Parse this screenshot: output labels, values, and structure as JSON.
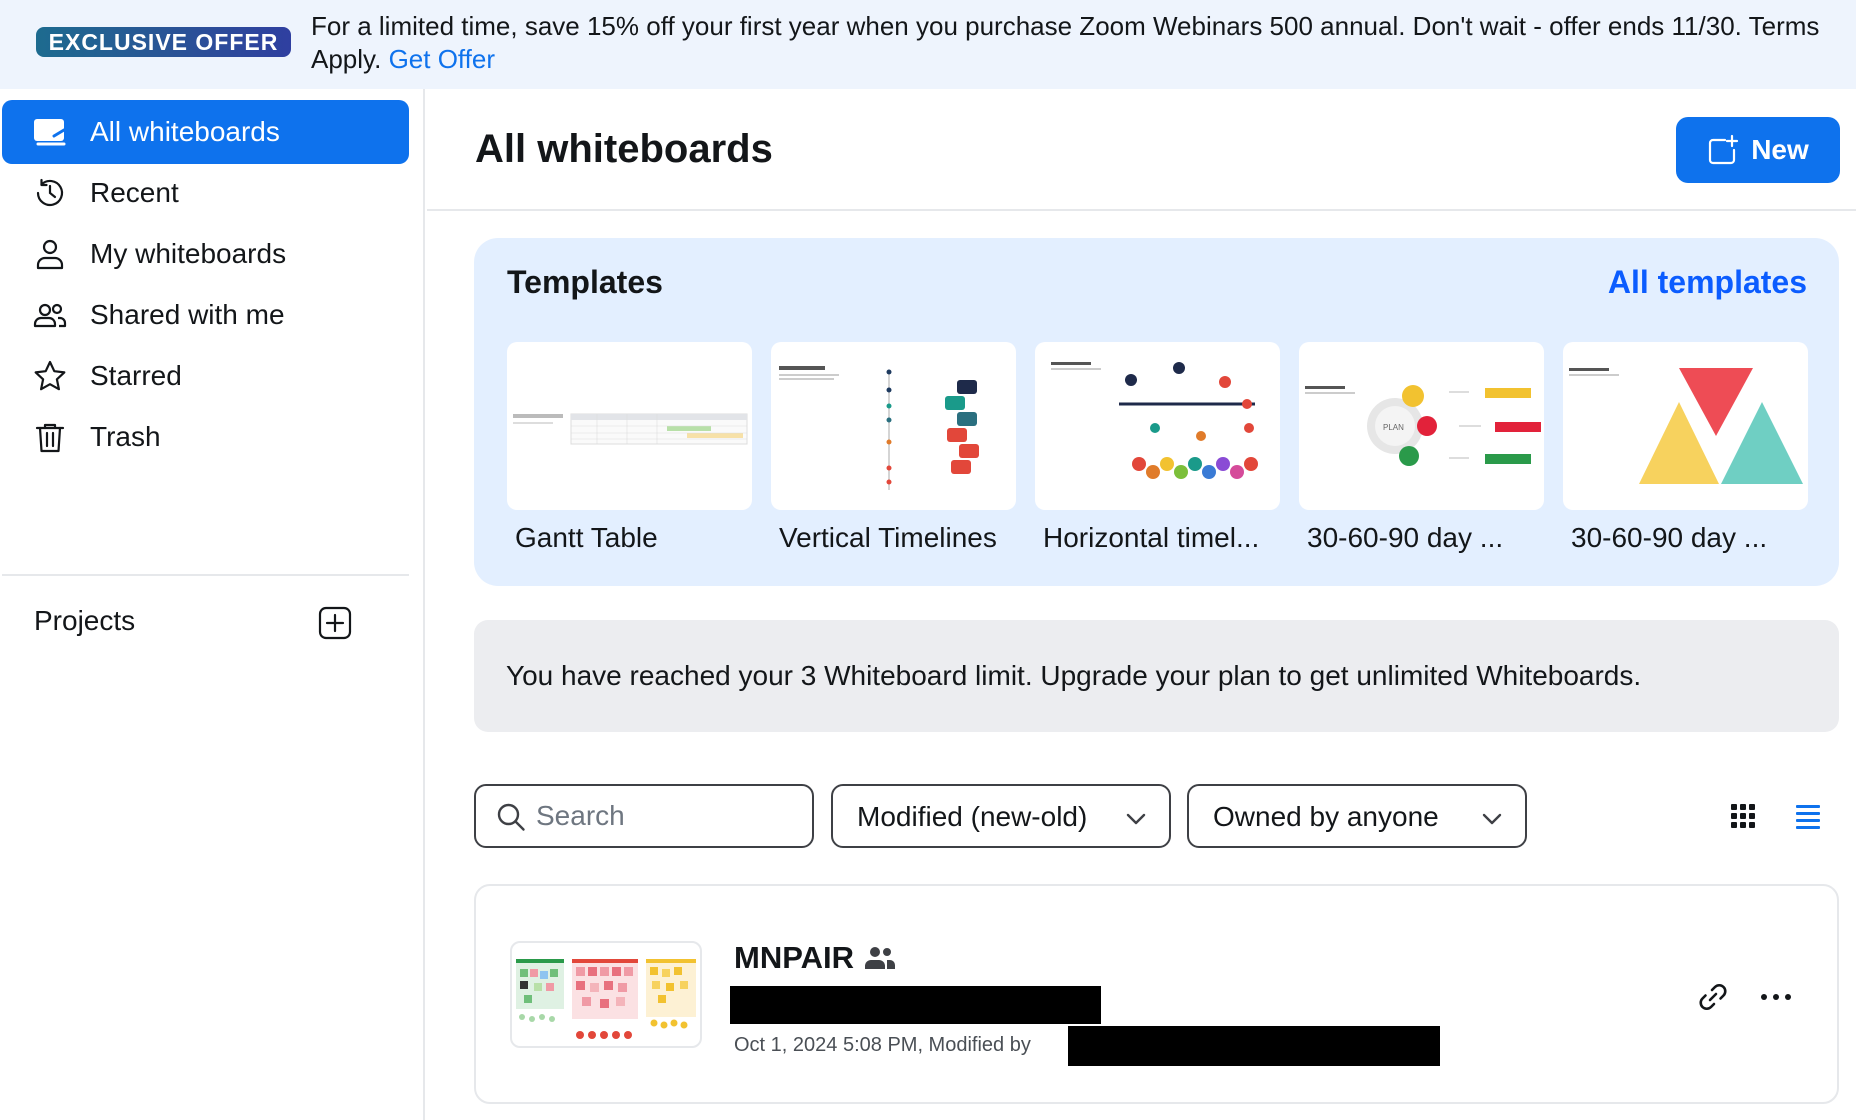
{
  "banner": {
    "badge": "EXCLUSIVE OFFER",
    "message": "For a limited time, save 15% off your first year when you purchase Zoom Webinars 500 annual. Don't wait - offer ends 11/30. Terms Apply.",
    "link": "Get Offer"
  },
  "sidebar": {
    "items": [
      {
        "label": "All whiteboards",
        "icon": "whiteboard-icon",
        "active": true
      },
      {
        "label": "Recent",
        "icon": "clock-icon"
      },
      {
        "label": "My whiteboards",
        "icon": "person-icon"
      },
      {
        "label": "Shared with me",
        "icon": "people-icon"
      },
      {
        "label": "Starred",
        "icon": "star-icon"
      },
      {
        "label": "Trash",
        "icon": "trash-icon"
      }
    ],
    "projects_label": "Projects"
  },
  "header": {
    "title": "All whiteboards",
    "new_label": "New"
  },
  "templates": {
    "title": "Templates",
    "all_link": "All templates",
    "items": [
      {
        "name": "Gantt Table"
      },
      {
        "name": "Vertical Timelines"
      },
      {
        "name": "Horizontal timel..."
      },
      {
        "name": "30-60-90 day ..."
      },
      {
        "name": "30-60-90 day ..."
      }
    ]
  },
  "notice": "You have reached your 3 Whiteboard limit. Upgrade your plan to get unlimited Whiteboards.",
  "filters": {
    "search_placeholder": "Search",
    "sort": "Modified (new-old)",
    "owner": "Owned by anyone"
  },
  "whiteboards": [
    {
      "title": "MNPAIR",
      "meta": "Oct 1, 2024 5:08 PM, Modified by"
    }
  ],
  "colors": {
    "accent": "#0e72ed",
    "link": "#0b5cff",
    "template_panel": "#e3efff",
    "banner_bg": "#eef4fd"
  }
}
